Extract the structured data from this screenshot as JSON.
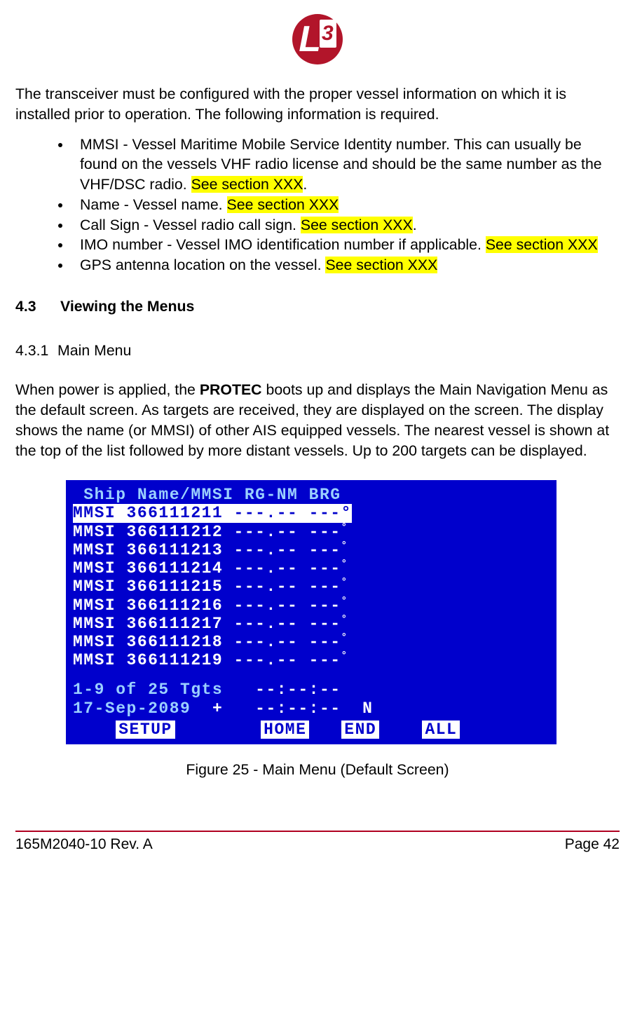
{
  "logo": {
    "letter": "L",
    "digit": "3"
  },
  "intro": "The transceiver must be configured with the proper vessel information on which it is installed prior to operation.  The following information is required.",
  "bullets": [
    {
      "pre": "MMSI - Vessel Maritime Mobile Service Identity number.  This can usually be found on the vessels VHF radio license and should be the same number as the VHF/DSC radio.  ",
      "hl": "See section XXX",
      "post": "."
    },
    {
      "pre": "Name - Vessel name.  ",
      "hl": "See section XXX",
      "post": ""
    },
    {
      "pre": "Call Sign - Vessel radio call sign.  ",
      "hl": "See section XXX",
      "post": "."
    },
    {
      "pre": "IMO number - Vessel IMO identification number if applicable.  ",
      "hl": "See section XXX",
      "post": ""
    },
    {
      "pre": "GPS antenna location on the vessel.  ",
      "hl": "See section XXX",
      "post": ""
    }
  ],
  "section43": {
    "num": "4.3",
    "title": "Viewing the Menus"
  },
  "section431": {
    "num": "4.3.1",
    "title": "Main Menu"
  },
  "para431_a": "When power is applied, the ",
  "para431_bold": "PROTEC",
  "para431_b": " boots up and displays the Main Navigation Menu as the default screen.  As targets are received, they are displayed on the screen.  The display shows the name (or MMSI) of other AIS equipped vessels.  The nearest vessel is shown at the top of the list followed by more distant vessels.  Up to 200 targets can be displayed.",
  "screen": {
    "header": " Ship Name/MMSI RG-NM BRG",
    "rows": [
      {
        "text": "MMSI 366111211 ---.-- ---",
        "selected": true
      },
      {
        "text": "MMSI 366111212 ---.-- ---",
        "selected": false
      },
      {
        "text": "MMSI 366111213 ---.-- ---",
        "selected": false
      },
      {
        "text": "MMSI 366111214 ---.-- ---",
        "selected": false
      },
      {
        "text": "MMSI 366111215 ---.-- ---",
        "selected": false
      },
      {
        "text": "MMSI 366111216 ---.-- ---",
        "selected": false
      },
      {
        "text": "MMSI 366111217 ---.-- ---",
        "selected": false
      },
      {
        "text": "MMSI 366111218 ---.-- ---",
        "selected": false
      },
      {
        "text": "MMSI 366111219 ---.-- ---",
        "selected": false
      }
    ],
    "status1_left": "1-9 of 25 Tgts   ",
    "status1_right": "--:--:--",
    "status2_left": "17-Sep-2089  ",
    "status2_mid": "+",
    "status2_right": "   --:--:--  N",
    "buttons": {
      "setup": "SETUP",
      "home": "HOME",
      "end": "END",
      "all": "ALL"
    }
  },
  "figure_caption": "Figure 25 - Main Menu (Default Screen)",
  "footer_left": "165M2040-10 Rev. A",
  "footer_right": "Page 42"
}
